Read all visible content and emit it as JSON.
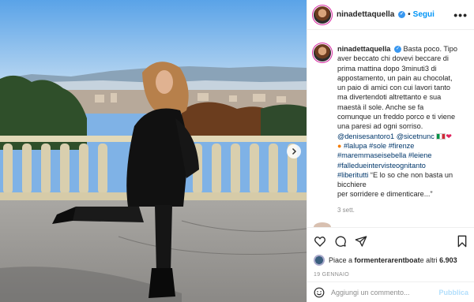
{
  "post": {
    "username": "ninadettaquella",
    "verified_symbol": "✓",
    "separator": "•",
    "follow_label": "Segui",
    "more_label": "•••"
  },
  "caption": {
    "text_lines": [
      "Basta poco. Tipo",
      "aver beccato chi dovevi beccare di",
      "prima mattina dopo 3minuti3 di",
      "appostamento, un pain au chocolat,",
      "un paio di amici con cui lavori tanto",
      "ma divertendoti altrettanto e sua",
      "maestà il sole. Anche se fa",
      "comunque un freddo porco e ti viene",
      "una paresi ad ogni sorriso."
    ],
    "mention_1": "@denisesantoro1",
    "mention_2": "@sicetnunc",
    "hashtags_line_1": "#lalupa #sole #firenze",
    "hashtags_line_2": "#maremmaseisebella #leiene",
    "hashtags_line_3": "#falledueintervisteognitanto",
    "hashtags_line_4": "#liberitutti",
    "quote_1": "“E lo so che non basta un",
    "quote_2": "bicchiere",
    "quote_3": "per sorridere e dimenticare...”",
    "time_ago": "3 sett."
  },
  "likes": {
    "prefix": "Piace a ",
    "liker": "formenterarentboat",
    "suffix": " e altri ",
    "count": "6.903"
  },
  "date": "19 GENNAIO",
  "comment": {
    "placeholder": "Aggiungi un commento...",
    "publish_label": "Pubblica"
  },
  "icons": [
    "heart-icon",
    "comment-icon",
    "share-icon",
    "bookmark-icon",
    "emoji-icon",
    "chevron-right-icon"
  ],
  "colors": {
    "accent": "#0095f6",
    "verified": "#3897f0",
    "hashtag": "#00376b",
    "publish_disabled": "#b2dffc"
  }
}
